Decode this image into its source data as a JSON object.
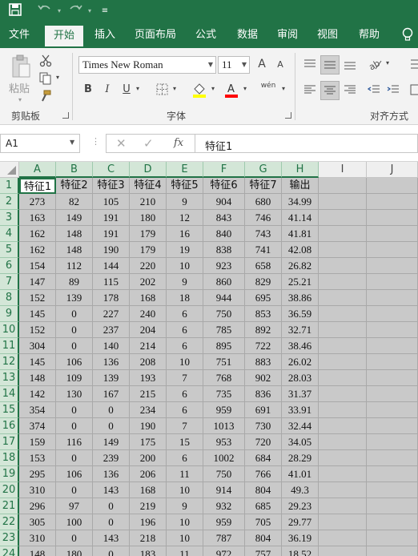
{
  "quick_access": {
    "save_icon": "save-icon",
    "undo_icon": "undo-icon",
    "redo_icon": "redo-icon",
    "customize_icon": "customize-qat-icon"
  },
  "tabs": [
    {
      "label": "文件",
      "active": false
    },
    {
      "label": "开始",
      "active": true
    },
    {
      "label": "插入",
      "active": false
    },
    {
      "label": "页面布局",
      "active": false
    },
    {
      "label": "公式",
      "active": false
    },
    {
      "label": "数据",
      "active": false
    },
    {
      "label": "审阅",
      "active": false
    },
    {
      "label": "视图",
      "active": false
    },
    {
      "label": "帮助",
      "active": false
    }
  ],
  "ribbon": {
    "paste_label": "粘贴",
    "clipboard_label": "剪贴板",
    "font_group_label": "字体",
    "alignment_label": "对齐方式",
    "font_name": "Times New Roman",
    "font_size": "11",
    "bold": "B",
    "italic": "I",
    "underline": "U",
    "grow_font": "A",
    "shrink_font": "A",
    "phonetic": "wén"
  },
  "formula_bar": {
    "name_box": "A1",
    "fx_label": "fx",
    "formula": "特征1"
  },
  "columns": [
    "A",
    "B",
    "C",
    "D",
    "E",
    "F",
    "G",
    "H",
    "I",
    "J"
  ],
  "header_row": [
    "特征1",
    "特征2",
    "特征3",
    "特征4",
    "特征5",
    "特征6",
    "特征7",
    "输出"
  ],
  "rows": [
    [
      "273",
      "82",
      "105",
      "210",
      "9",
      "904",
      "680",
      "34.99"
    ],
    [
      "163",
      "149",
      "191",
      "180",
      "12",
      "843",
      "746",
      "41.14"
    ],
    [
      "162",
      "148",
      "191",
      "179",
      "16",
      "840",
      "743",
      "41.81"
    ],
    [
      "162",
      "148",
      "190",
      "179",
      "19",
      "838",
      "741",
      "42.08"
    ],
    [
      "154",
      "112",
      "144",
      "220",
      "10",
      "923",
      "658",
      "26.82"
    ],
    [
      "147",
      "89",
      "115",
      "202",
      "9",
      "860",
      "829",
      "25.21"
    ],
    [
      "152",
      "139",
      "178",
      "168",
      "18",
      "944",
      "695",
      "38.86"
    ],
    [
      "145",
      "0",
      "227",
      "240",
      "6",
      "750",
      "853",
      "36.59"
    ],
    [
      "152",
      "0",
      "237",
      "204",
      "6",
      "785",
      "892",
      "32.71"
    ],
    [
      "304",
      "0",
      "140",
      "214",
      "6",
      "895",
      "722",
      "38.46"
    ],
    [
      "145",
      "106",
      "136",
      "208",
      "10",
      "751",
      "883",
      "26.02"
    ],
    [
      "148",
      "109",
      "139",
      "193",
      "7",
      "768",
      "902",
      "28.03"
    ],
    [
      "142",
      "130",
      "167",
      "215",
      "6",
      "735",
      "836",
      "31.37"
    ],
    [
      "354",
      "0",
      "0",
      "234",
      "6",
      "959",
      "691",
      "33.91"
    ],
    [
      "374",
      "0",
      "0",
      "190",
      "7",
      "1013",
      "730",
      "32.44"
    ],
    [
      "159",
      "116",
      "149",
      "175",
      "15",
      "953",
      "720",
      "34.05"
    ],
    [
      "153",
      "0",
      "239",
      "200",
      "6",
      "1002",
      "684",
      "28.29"
    ],
    [
      "295",
      "106",
      "136",
      "206",
      "11",
      "750",
      "766",
      "41.01"
    ],
    [
      "310",
      "0",
      "143",
      "168",
      "10",
      "914",
      "804",
      "49.3"
    ],
    [
      "296",
      "97",
      "0",
      "219",
      "9",
      "932",
      "685",
      "29.23"
    ],
    [
      "305",
      "100",
      "0",
      "196",
      "10",
      "959",
      "705",
      "29.77"
    ],
    [
      "310",
      "0",
      "143",
      "218",
      "10",
      "787",
      "804",
      "36.19"
    ],
    [
      "148",
      "180",
      "0",
      "183",
      "11",
      "972",
      "757",
      "18.52"
    ]
  ]
}
